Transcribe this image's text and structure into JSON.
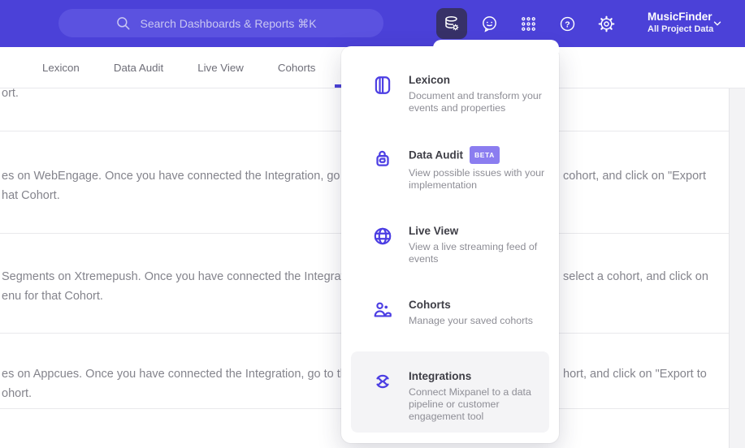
{
  "colors": {
    "header_bg": "#4b41d8",
    "search_pill_bg": "#5b52e0",
    "accent": "#4c3ee3",
    "active_icon_bg": "#373168",
    "beta_badge_bg": "#8b7df0",
    "menu_highlight_bg": "#f4f4f6",
    "body_text": "#84848c"
  },
  "header": {
    "search_placeholder": "Search Dashboards & Reports ⌘K",
    "project_name": "MusicFinder",
    "project_subtitle": "All Project Data",
    "icons": [
      "database-gear",
      "feedback-smiley",
      "apps-grid",
      "help",
      "settings",
      "chevron-down"
    ]
  },
  "tabs": [
    {
      "label": "Lexicon"
    },
    {
      "label": "Data Audit"
    },
    {
      "label": "Live View"
    },
    {
      "label": "Cohorts"
    }
  ],
  "menu": {
    "items": [
      {
        "icon": "book-icon",
        "title": "Lexicon",
        "desc": "Document and transform your events and properties"
      },
      {
        "icon": "lock-swirl-icon",
        "title": "Data Audit",
        "badge": "BETA",
        "desc": "View possible issues with your implementation"
      },
      {
        "icon": "globe-icon",
        "title": "Live View",
        "desc": "View a live streaming feed of events"
      },
      {
        "icon": "people-icon",
        "title": "Cohorts",
        "desc": "Manage your saved cohorts"
      },
      {
        "icon": "sync-arrows-icon",
        "title": "Integrations",
        "desc": "Connect Mixpanel to a data pipeline or customer engagement tool",
        "highlighted": true
      }
    ]
  },
  "background_text": {
    "row1": {
      "line1": "ort."
    },
    "row2": {
      "line1": "es on WebEngage. Once you have connected the Integration, go to the",
      "line2": "hat Cohort.",
      "right": "cohort, and click on \"Export"
    },
    "row3": {
      "line1": "Segments on Xtremepush. Once you have connected the Integration,",
      "line2": "enu for that Cohort.",
      "right": "select a cohort, and click on"
    },
    "row4": {
      "line1": "es on Appcues. Once you have connected the Integration, go to the M",
      "line2": "ohort.",
      "right": "hort, and click on \"Export to"
    }
  }
}
